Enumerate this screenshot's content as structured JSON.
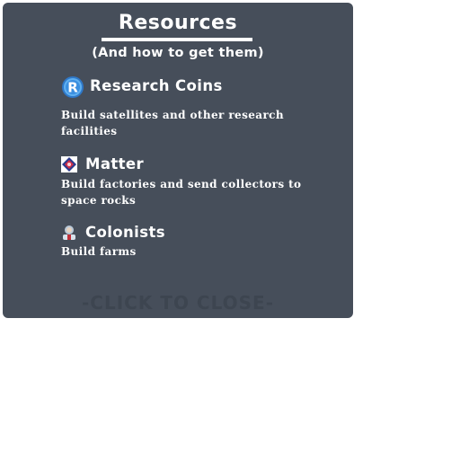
{
  "panel": {
    "title": "Resources",
    "subtitle": "(And how to get them)",
    "close_label": "-CLICK TO CLOSE-"
  },
  "resources": [
    {
      "name": "Research Coins",
      "description": "Build satellites and other research facilities",
      "icon": "research-coin-icon",
      "icon_letter": "R",
      "icon_color": "#3b8fe0"
    },
    {
      "name": "Matter",
      "description": "Build factories and send collectors to space rocks",
      "icon": "matter-icon",
      "icon_color": "#d0304a"
    },
    {
      "name": "Colonists",
      "description": "Build farms",
      "icon": "colonist-icon",
      "icon_color": "#b9c8d8"
    }
  ],
  "colors": {
    "panel_bg": "#464e5a",
    "text": "#ffffff",
    "close_text": "#3d4550"
  }
}
